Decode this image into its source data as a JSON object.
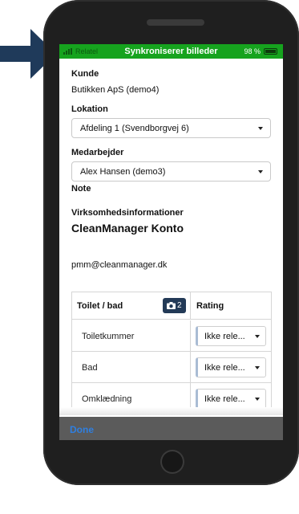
{
  "status_bar": {
    "carrier": "Relatel",
    "title": "Synkroniserer billeder",
    "battery": "98 %",
    "battery_level_percent": 98,
    "background_color": "#16a31e"
  },
  "form": {
    "kunde_label": "Kunde",
    "kunde_value": "Butikken ApS (demo4)",
    "lokation_label": "Lokation",
    "lokation_value": "Afdeling 1 (Svendborgvej 6)",
    "medarbejder_label": "Medarbejder",
    "medarbejder_value": "Alex Hansen (demo3)",
    "note_label": "Note",
    "info_label": "Virksomhedsinformationer",
    "account_name": "CleanManager Konto",
    "email": "pmm@cleanmanager.dk"
  },
  "table": {
    "section_title": "Toilet / bad",
    "camera_count": "2",
    "rating_header": "Rating",
    "rows": [
      {
        "name": "Toiletkummer",
        "rating": "Ikke rele..."
      },
      {
        "name": "Bad",
        "rating": "Ikke rele..."
      },
      {
        "name": "Omklædning",
        "rating": "Ikke rele..."
      }
    ]
  },
  "toolbar": {
    "done_label": "Done"
  },
  "icons": [
    "arrow-right-icon",
    "signal-icon",
    "battery-icon",
    "camera-icon",
    "caret-down-icon"
  ],
  "colors": {
    "arrow": "#1f3a5a",
    "camera_button": "#233a57",
    "done_link": "#2f7fe0"
  }
}
